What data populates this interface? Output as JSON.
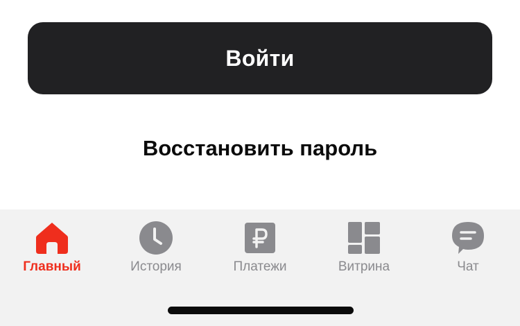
{
  "login": {
    "button_label": "Войти"
  },
  "restore_password": {
    "label": "Восстановить пароль"
  },
  "tabbar": {
    "active_color": "#EF2E1D",
    "inactive_color": "#8A8A8E",
    "items": [
      {
        "label": "Главный",
        "icon": "home-icon",
        "active": true
      },
      {
        "label": "История",
        "icon": "clock-icon",
        "active": false
      },
      {
        "label": "Платежи",
        "icon": "ruble-icon",
        "active": false
      },
      {
        "label": "Витрина",
        "icon": "showcase-grid-icon",
        "active": false
      },
      {
        "label": "Чат",
        "icon": "chat-bubble-icon",
        "active": false
      }
    ]
  }
}
